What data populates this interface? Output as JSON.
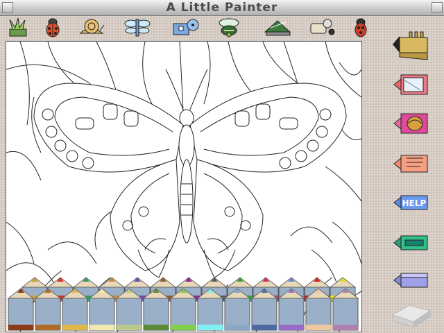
{
  "window": {
    "title": "A Little Painter"
  },
  "toolbar": {
    "tools": [
      {
        "name": "grass-picture-icon"
      },
      {
        "name": "ladybug-picture-icon"
      },
      {
        "name": "snail-picture-icon"
      },
      {
        "name": "dragonfly-picture-icon"
      },
      {
        "name": "fish-picture-icon"
      },
      {
        "name": "bee-picture-icon"
      },
      {
        "name": "flag-picture-icon"
      },
      {
        "name": "magnifier-picture-icon"
      },
      {
        "name": "beetle-picture-icon"
      }
    ]
  },
  "sidebar": {
    "help_label": "HELP",
    "buttons": [
      {
        "name": "trumpet-sound-button"
      },
      {
        "name": "new-page-button"
      },
      {
        "name": "open-picture-button"
      },
      {
        "name": "hand-button"
      },
      {
        "name": "help-button"
      },
      {
        "name": "print-button"
      },
      {
        "name": "eraser-tool-button"
      },
      {
        "name": "eraser-block-button"
      }
    ]
  },
  "palette": {
    "colors_top": [
      "#c7a23a",
      "#d22f2f",
      "#2ea05e",
      "#c98a3d",
      "#6c4bb0",
      "#8b5a3a",
      "#8a2a8a",
      "#5a5a5a",
      "#3aa03a",
      "#cc3366",
      "#6688cc",
      "#cc2222",
      "#dddd22"
    ],
    "colors_bottom": [
      "#8b3a1a",
      "#b06a2a",
      "#e0b84a",
      "#f3e9b0",
      "#b8c98a",
      "#5d8a3a",
      "#7ed04a",
      "#80f0f0",
      "#8aa8c8",
      "#4a6aa0",
      "#9a6ac8",
      "#f0c8a0",
      "#b080b0"
    ]
  },
  "colors": {
    "toolbar_bg": "#c8c8c8",
    "canvas_bg": "#ffffff",
    "panel_bg": "#d6ccc4"
  }
}
